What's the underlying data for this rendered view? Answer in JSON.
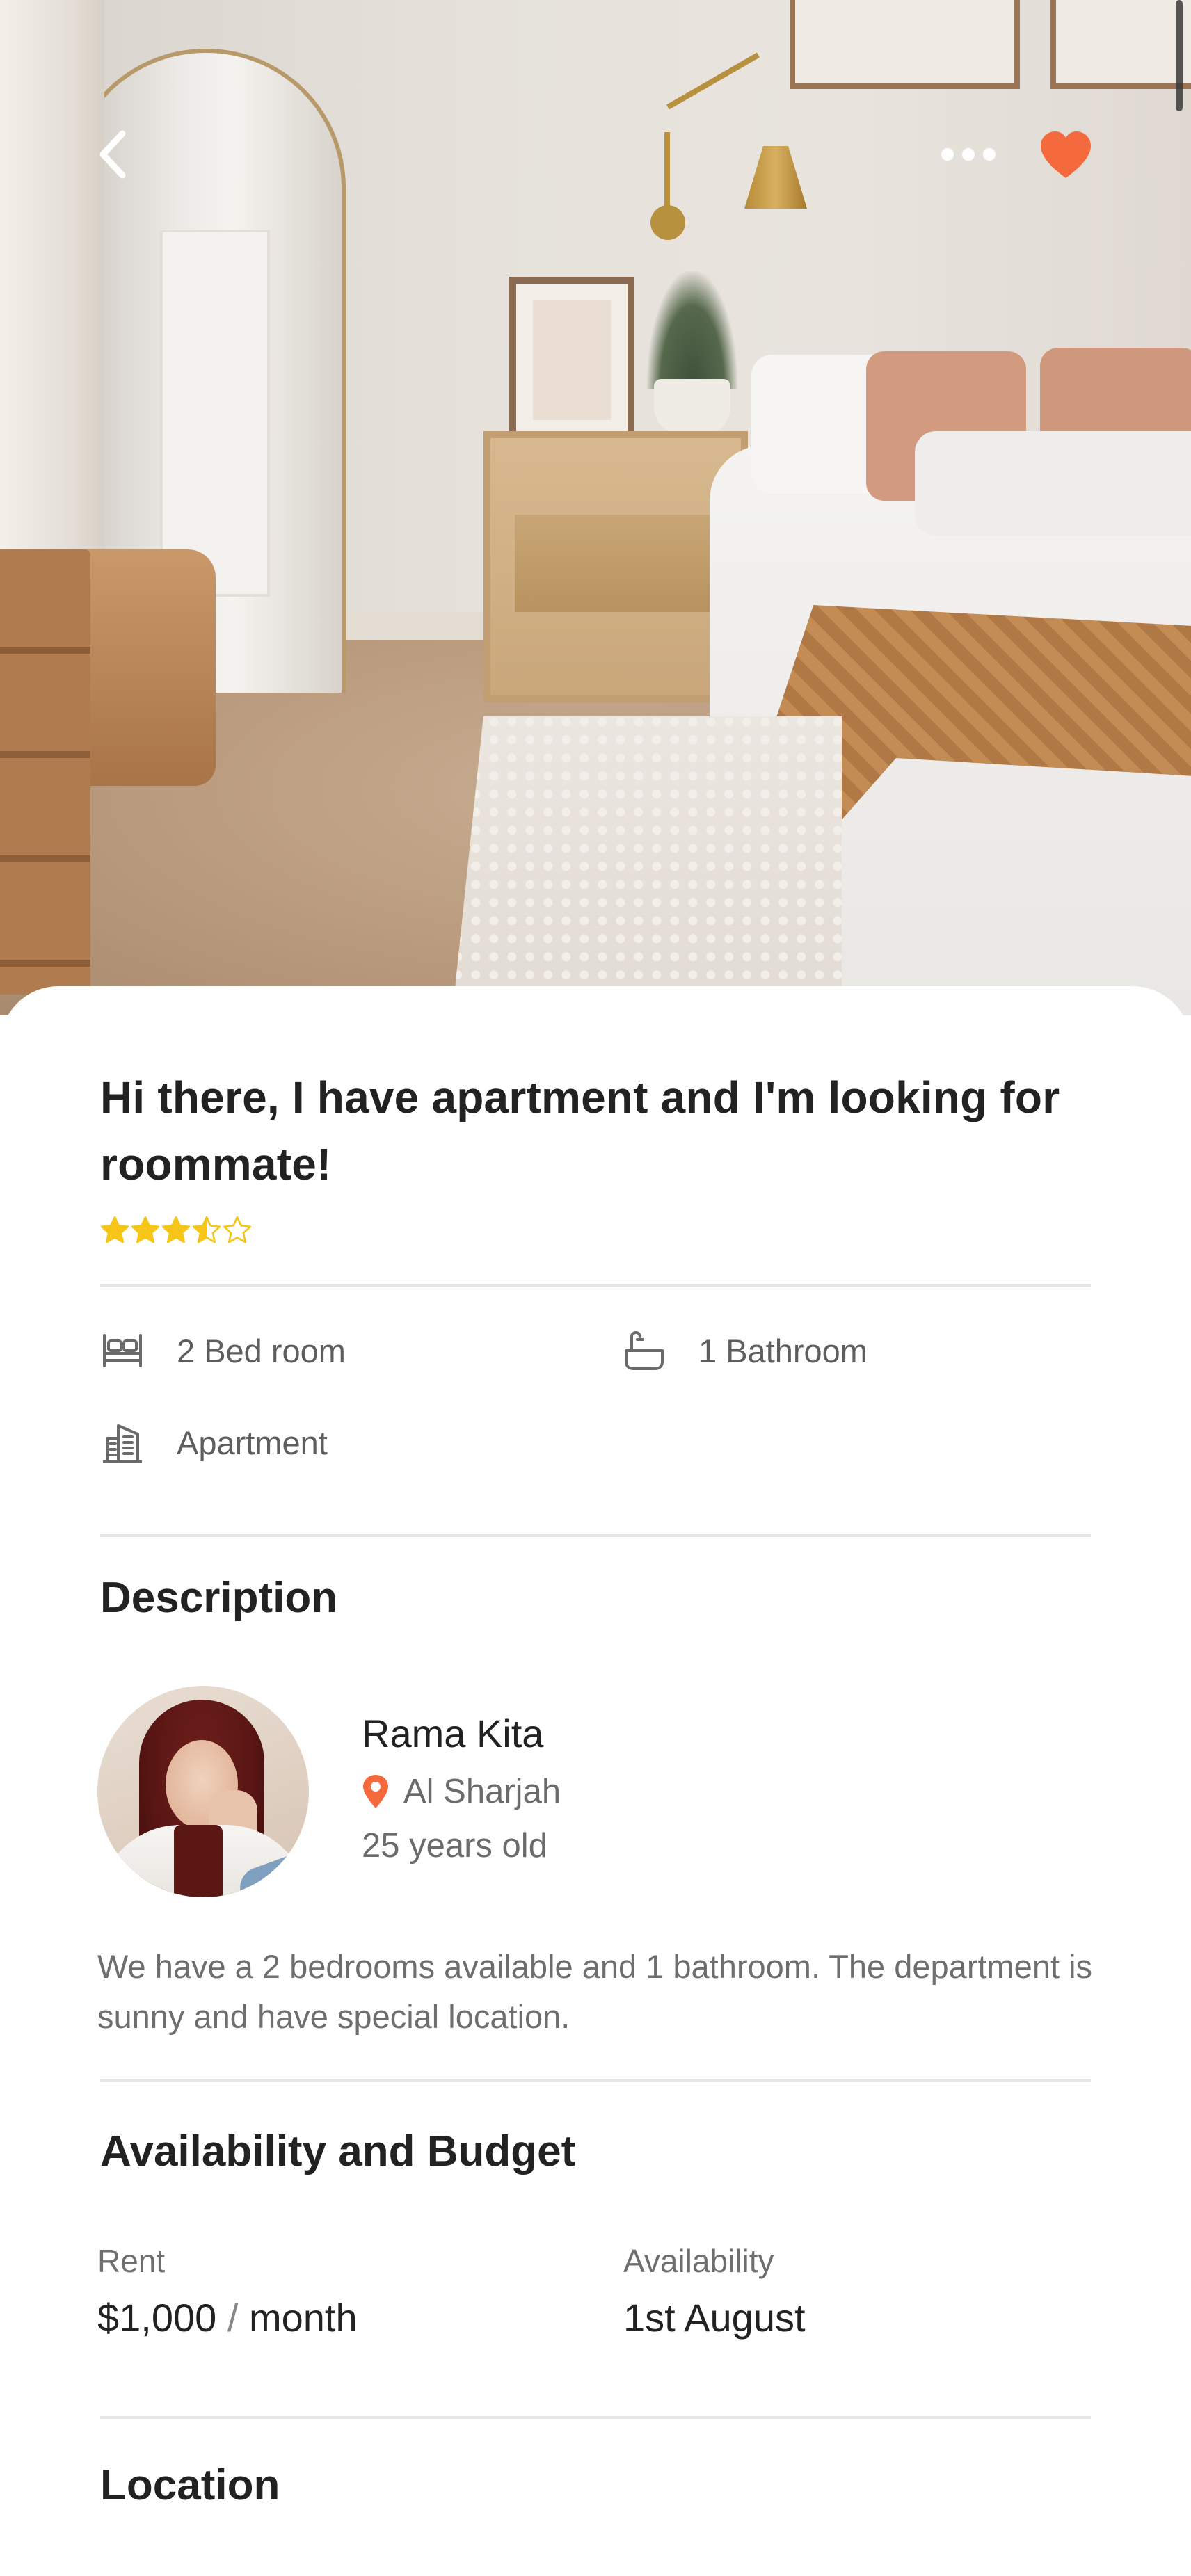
{
  "header": {
    "back_icon": "chevron-left-icon",
    "more_icon": "more-horizontal-icon",
    "favorite_icon": "heart-filled-icon",
    "favorite_color": "#F46A3D"
  },
  "listing": {
    "title": "Hi there, I have apartment and I'm looking for roommate!",
    "rating": 3.5,
    "rating_max": 5,
    "star_color": "#F5C518",
    "features": {
      "bedrooms": {
        "icon": "bed-icon",
        "label": "2 Bed room"
      },
      "bathrooms": {
        "icon": "bathtub-icon",
        "label": "1 Bathroom"
      },
      "type": {
        "icon": "building-icon",
        "label": "Apartment"
      }
    }
  },
  "description": {
    "heading": "Description",
    "person": {
      "name": "Rama Kita",
      "location_icon": "map-pin-icon",
      "location_color": "#F46A3D",
      "location": "Al Sharjah",
      "age": "25 years old"
    },
    "text": "We have a 2 bedrooms available and 1 bathroom. The department is sunny and have special location."
  },
  "availability": {
    "heading": "Availability and  Budget",
    "rent_label": "Rent",
    "rent_amount": "$1,000",
    "rent_sep": "/",
    "rent_period": "month",
    "availability_label": "Availability",
    "availability_value": "1st August"
  },
  "location": {
    "heading": "Location"
  }
}
